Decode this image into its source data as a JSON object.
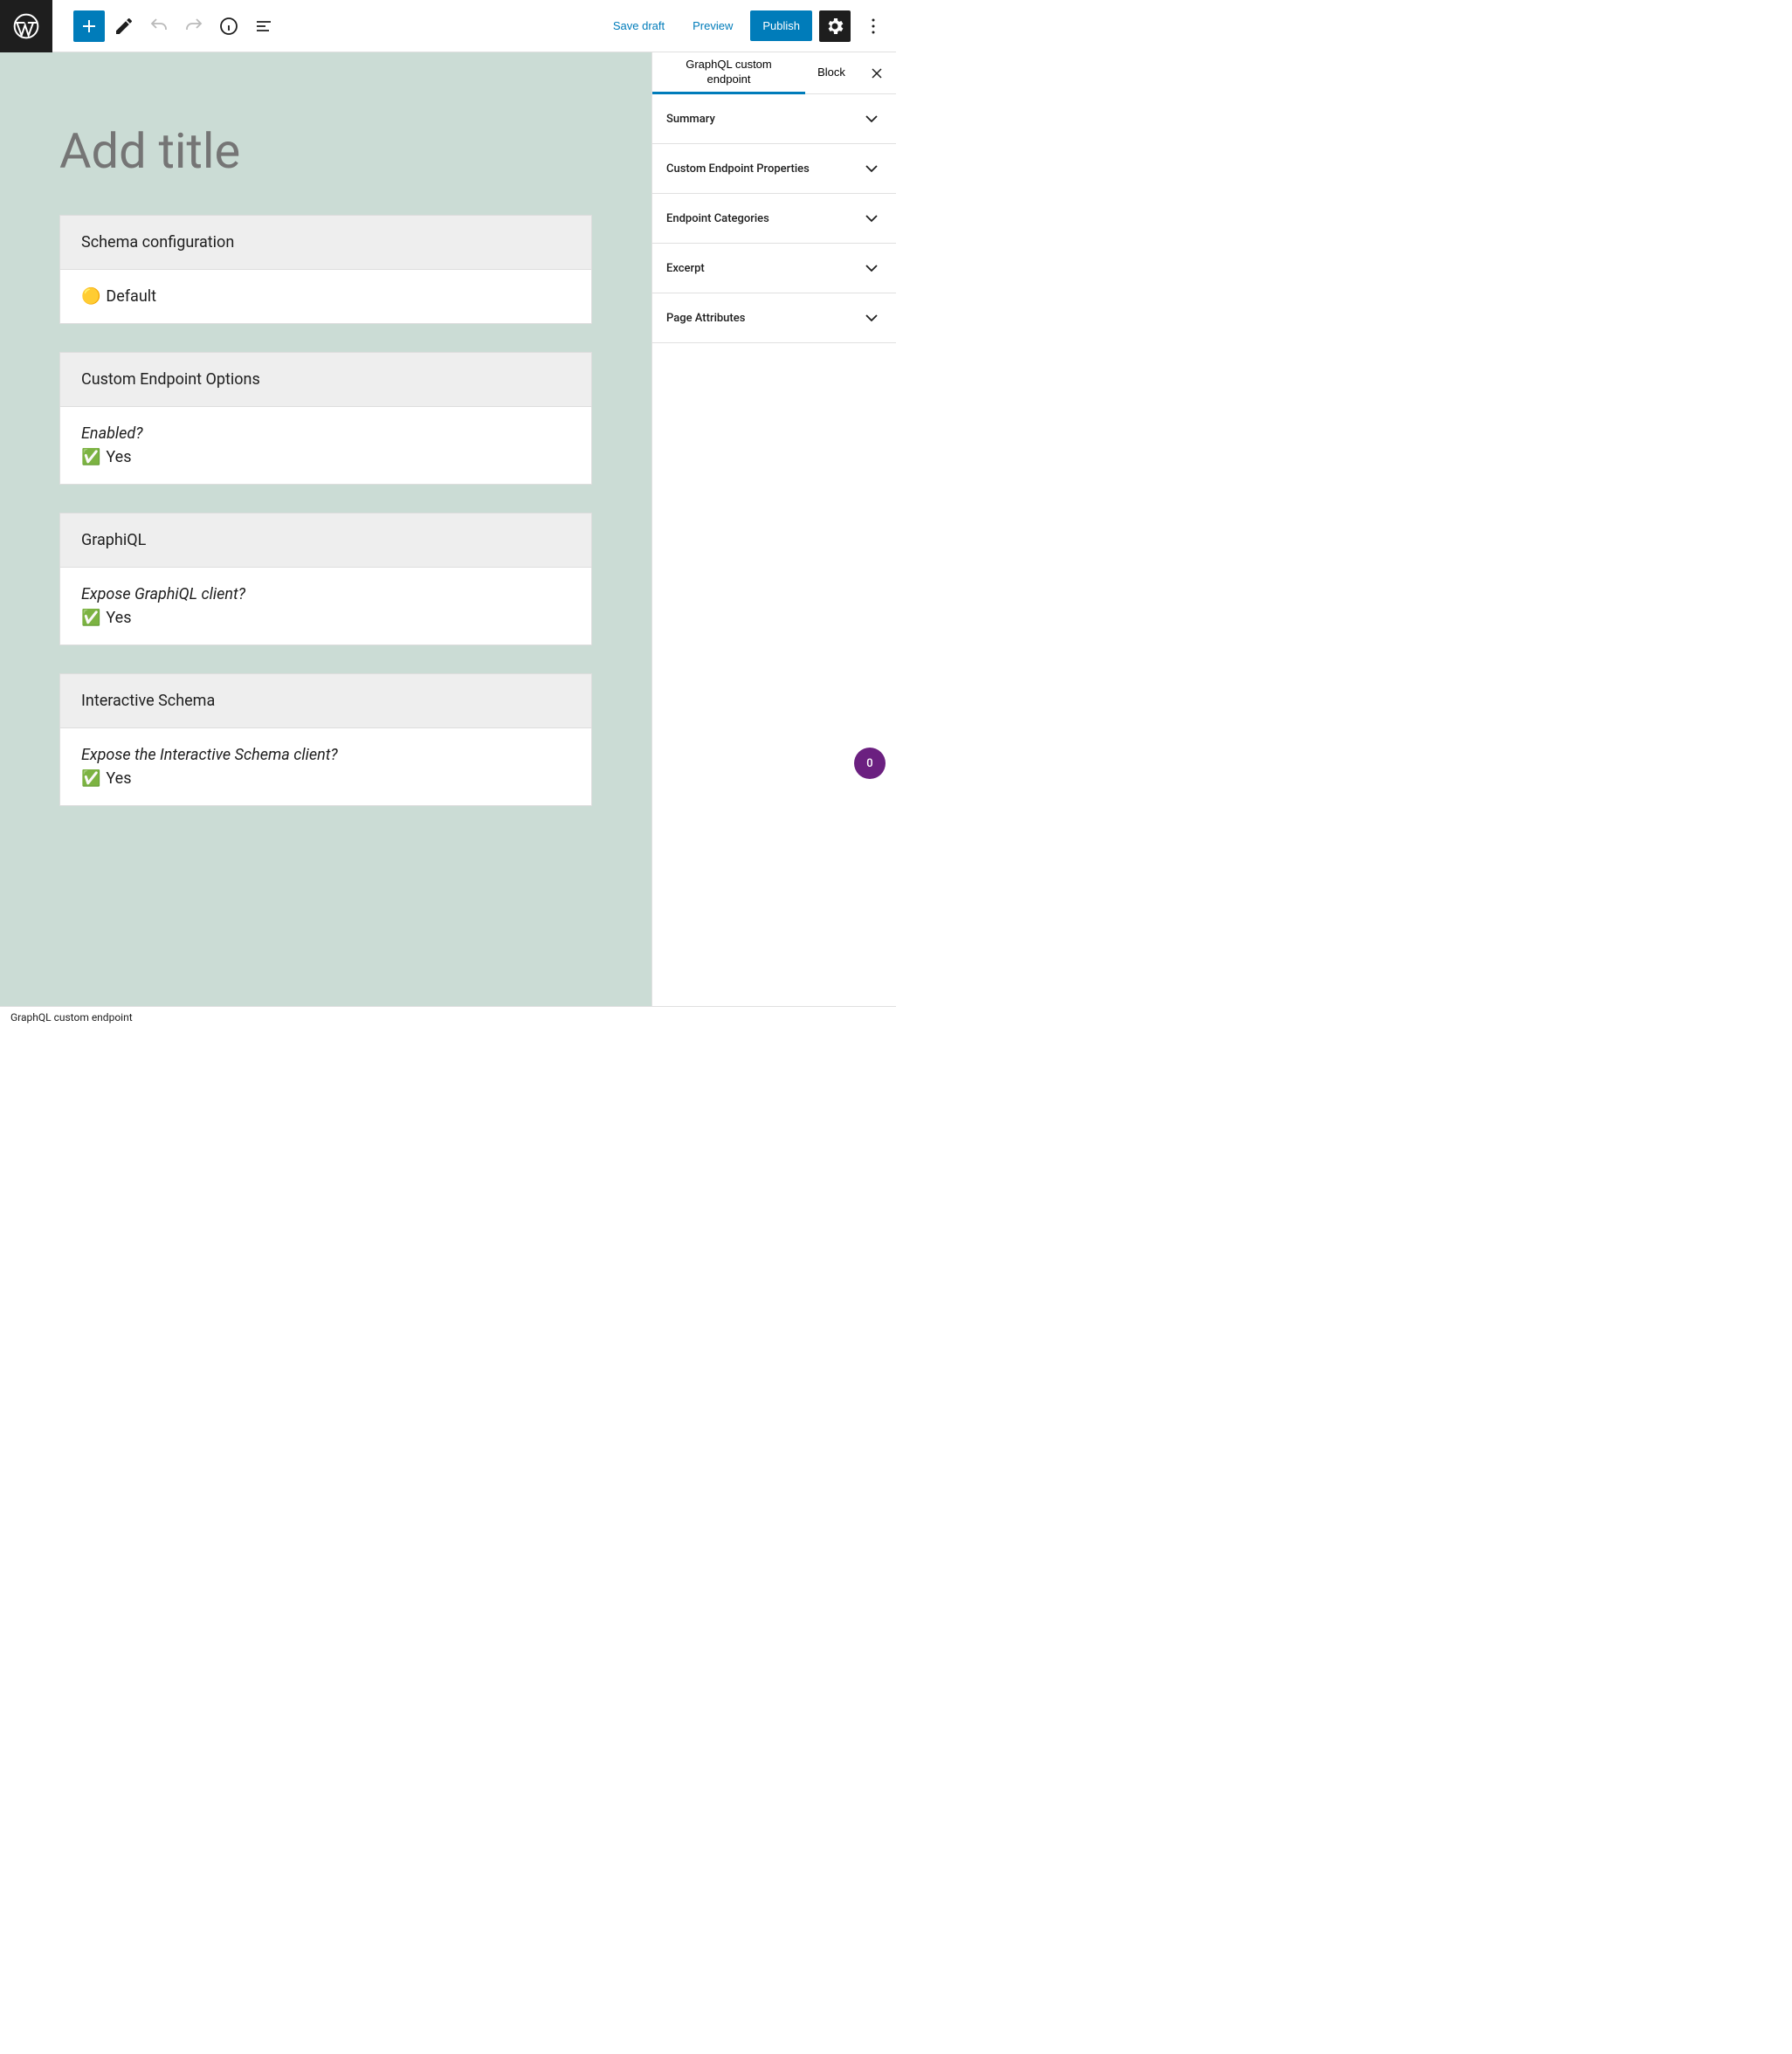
{
  "toolbar": {
    "save_draft": "Save draft",
    "preview": "Preview",
    "publish": "Publish"
  },
  "editor": {
    "title_placeholder": "Add title",
    "blocks": [
      {
        "header": "Schema configuration",
        "rows": [
          {
            "icon": "🟡",
            "value": "Default"
          }
        ]
      },
      {
        "header": "Custom Endpoint Options",
        "rows": [
          {
            "question": "Enabled?",
            "icon": "✅",
            "value": "Yes"
          }
        ]
      },
      {
        "header": "GraphiQL",
        "rows": [
          {
            "question": "Expose GraphiQL client?",
            "icon": "✅",
            "value": "Yes"
          }
        ]
      },
      {
        "header": "Interactive Schema",
        "rows": [
          {
            "question": "Expose the Interactive Schema client?",
            "icon": "✅",
            "value": "Yes"
          }
        ]
      }
    ]
  },
  "sidebar": {
    "tabs": {
      "document": "GraphQL custom endpoint",
      "block": "Block"
    },
    "panels": [
      "Summary",
      "Custom Endpoint Properties",
      "Endpoint Categories",
      "Excerpt",
      "Page Attributes"
    ]
  },
  "fab": {
    "count": "0"
  },
  "footer": {
    "breadcrumb": "GraphQL custom endpoint"
  }
}
